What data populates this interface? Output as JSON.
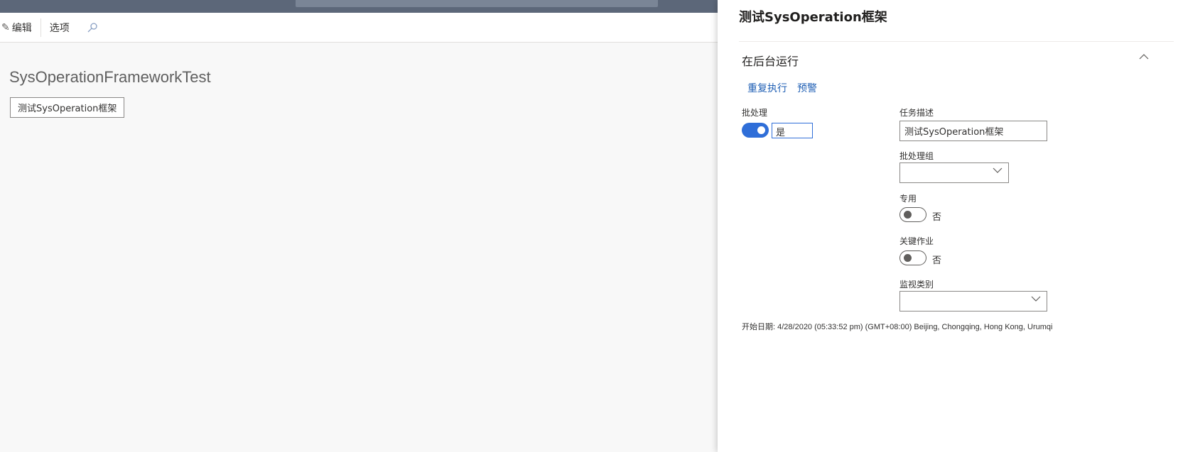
{
  "toolbar": {
    "edit_label": "编辑",
    "options_label": "选项"
  },
  "page": {
    "title": "SysOperationFrameworkTest",
    "button_label": "测试SysOperation框架"
  },
  "dialog": {
    "title": "测试SysOperation框架",
    "section_title": "在后台运行",
    "links": [
      "重复执行",
      "预警"
    ],
    "batch": {
      "label": "批处理",
      "value": "是",
      "enabled": true
    },
    "task_description": {
      "label": "任务描述",
      "value": "测试SysOperation框架"
    },
    "batch_group": {
      "label": "批处理组",
      "value": ""
    },
    "private": {
      "label": "专用",
      "value": "否",
      "enabled": false
    },
    "critical_job": {
      "label": "关键作业",
      "value": "否",
      "enabled": false
    },
    "monitoring_category": {
      "label": "监视类别",
      "value": ""
    },
    "start_date": "开始日期: 4/28/2020 (05:33:52 pm) (GMT+08:00) Beijing, Chongqing, Hong Kong, Urumqi"
  },
  "colors": {
    "accent": "#2f6ed8",
    "link": "#1f5fb4",
    "topbar": "#5c6779"
  }
}
